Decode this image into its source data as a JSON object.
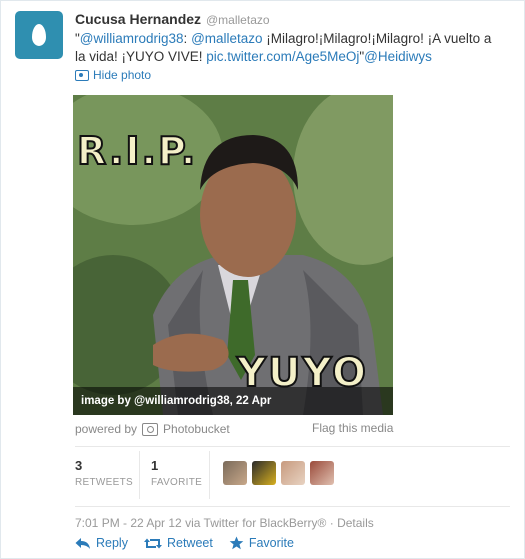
{
  "tweet": {
    "author_name": "Cucusa Hernandez",
    "author_handle": "@malletazo",
    "text_parts": {
      "q1": "\"",
      "mention1": "@williamrodrig38",
      "colon": ": ",
      "mention2": "@malletazo",
      "t1": " ¡Milagro!¡Milagro!¡Milagro! ¡A vuelto a la vida! ¡YUYO VIVE! ",
      "link": "pic.twitter.com/Age5MeOj",
      "q2": "\"",
      "mention3": "@Heidiwys"
    },
    "hide_photo_label": "Hide photo",
    "media": {
      "overlay_top": "R.I.P.",
      "overlay_bottom": "YUYO",
      "caption": "image by @williamrodrig38, 22 Apr"
    },
    "powered_by_label": "powered by",
    "provider": "Photobucket",
    "flag_label": "Flag this media",
    "stats": {
      "retweets_count": "3",
      "retweets_label": "RETWEETS",
      "favorites_count": "1",
      "favorites_label": "FAVORITE"
    },
    "meta": {
      "timestamp": "7:01 PM - 22 Apr 12",
      "via": " via Twitter for BlackBerry®",
      "sep": " · ",
      "details": "Details"
    },
    "actions": {
      "reply": "Reply",
      "retweet": "Retweet",
      "favorite": "Favorite"
    }
  },
  "colors": {
    "link": "#2b7bb9",
    "avatar_bg": "#2f8fb0"
  },
  "icons": [
    "egg-avatar-icon",
    "photo-icon",
    "camera-icon",
    "reply-icon",
    "retweet-icon",
    "star-icon"
  ]
}
